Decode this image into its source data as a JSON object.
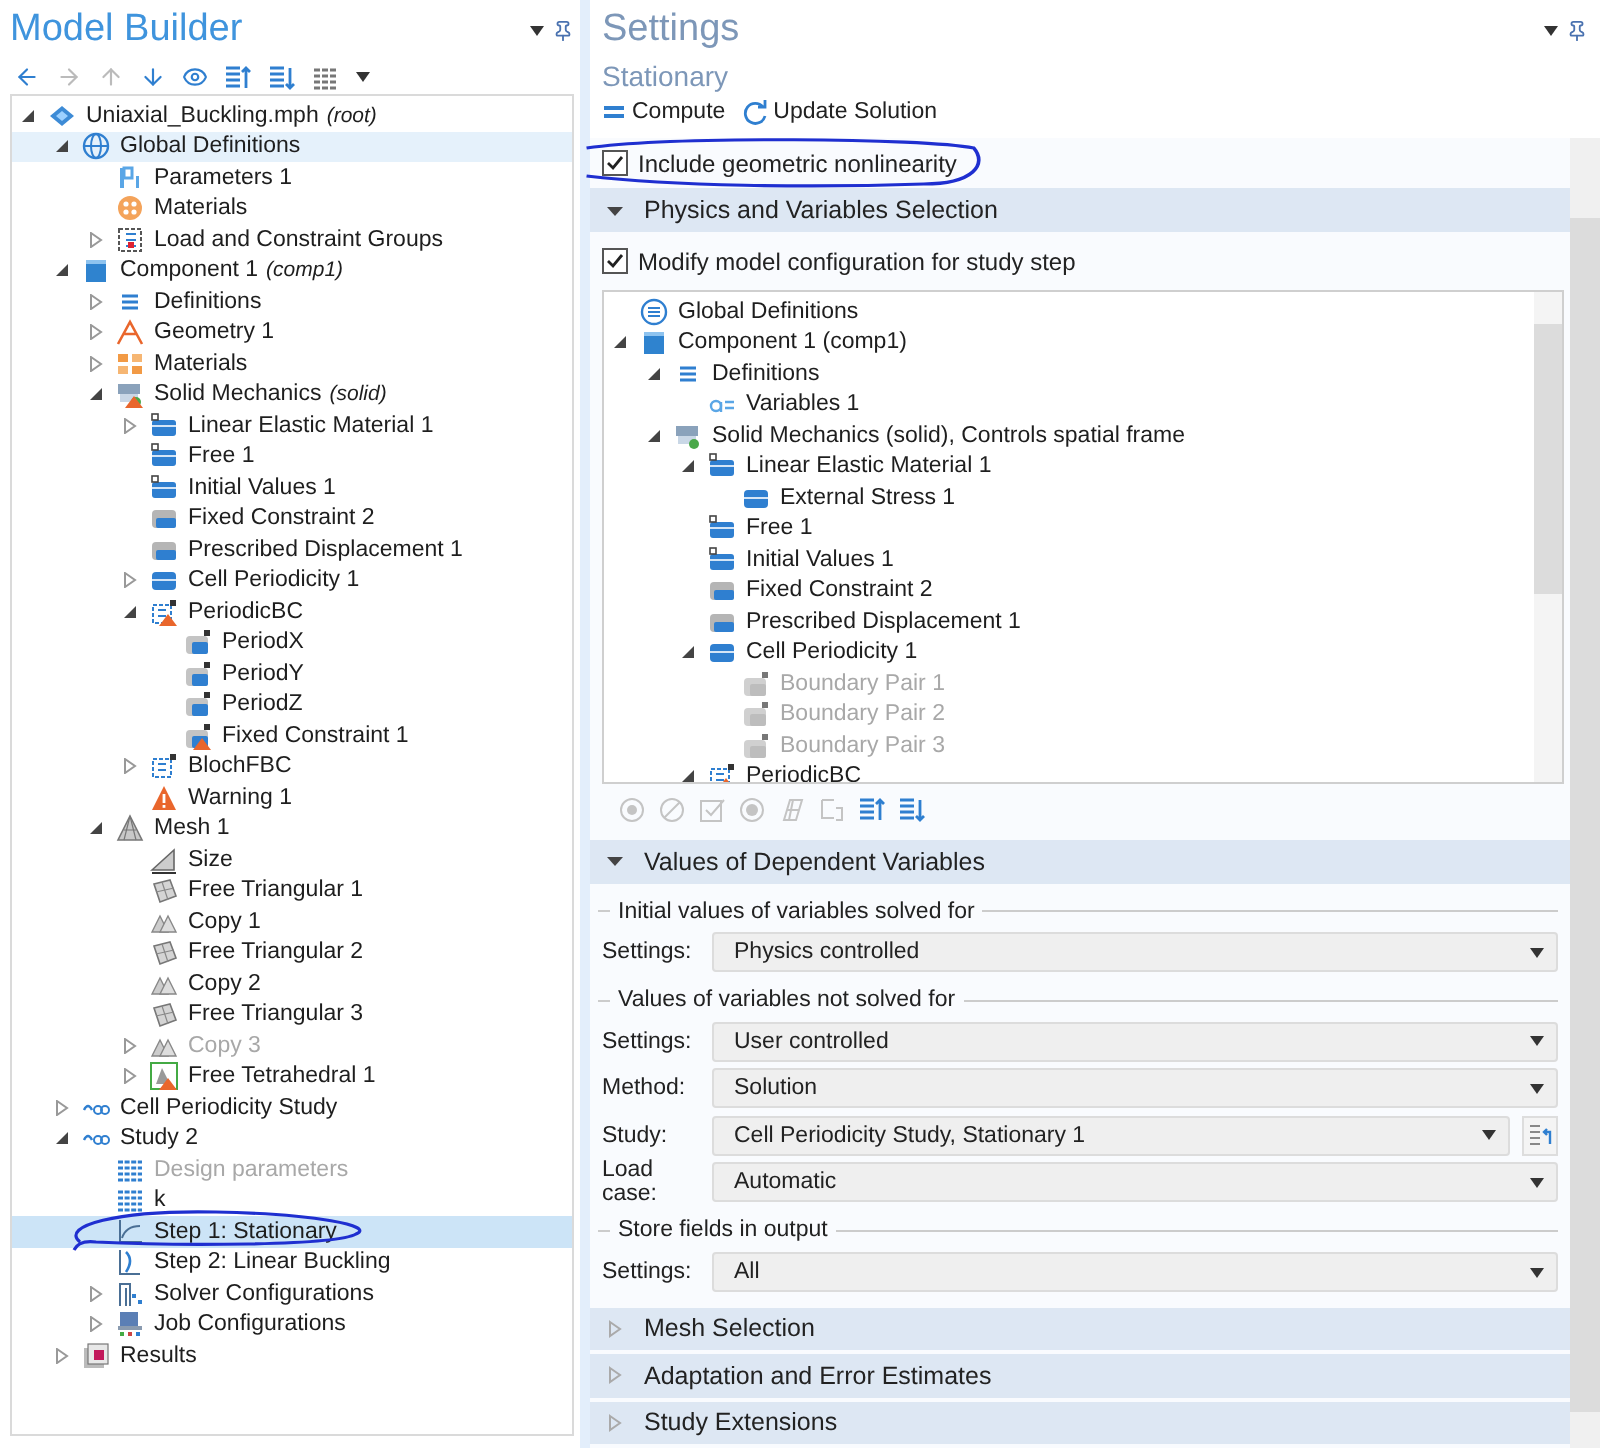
{
  "model_builder": {
    "title": "Model Builder",
    "tree": [
      {
        "label": "Uniaxial_Buckling.mph",
        "note": "(root)",
        "kind": "model",
        "expanded": true,
        "selected": false,
        "children": [
          {
            "label": "Global Definitions",
            "kind": "globe",
            "expanded": true,
            "selected": false,
            "hovered": true,
            "children": [
              {
                "label": "Parameters 1",
                "kind": "param",
                "selected": false
              },
              {
                "label": "Materials",
                "kind": "material",
                "selected": false
              },
              {
                "label": "Load and Constraint Groups",
                "kind": "group",
                "expanded": false,
                "selected": false
              }
            ]
          },
          {
            "label": "Component 1",
            "note": "(comp1)",
            "kind": "component",
            "expanded": true,
            "selected": false,
            "children": [
              {
                "label": "Definitions",
                "kind": "list",
                "expanded": false,
                "selected": false
              },
              {
                "label": "Geometry 1",
                "kind": "geometry",
                "expanded": false,
                "selected": false
              },
              {
                "label": "Materials",
                "kind": "blocks",
                "expanded": false,
                "selected": false
              },
              {
                "label": "Solid Mechanics",
                "note": "(solid)",
                "kind": "physics",
                "warning": true,
                "expanded": true,
                "selected": false,
                "children": [
                  {
                    "label": "Linear Elastic Material 1",
                    "kind": "domain",
                    "expanded": false,
                    "selected": false
                  },
                  {
                    "label": "Free 1",
                    "kind": "domain",
                    "selected": false
                  },
                  {
                    "label": "Initial Values 1",
                    "kind": "domain",
                    "selected": false
                  },
                  {
                    "label": "Fixed Constraint 2",
                    "kind": "boundary-grey",
                    "selected": false
                  },
                  {
                    "label": "Prescribed Displacement 1",
                    "kind": "boundary-grey",
                    "selected": false
                  },
                  {
                    "label": "Cell Periodicity 1",
                    "kind": "boundary",
                    "expanded": false,
                    "selected": false
                  },
                  {
                    "label": "PeriodicBC",
                    "kind": "periodic",
                    "warning": true,
                    "expanded": true,
                    "selected": false,
                    "children": [
                      {
                        "label": "PeriodX",
                        "kind": "pair",
                        "selected": false
                      },
                      {
                        "label": "PeriodY",
                        "kind": "pair",
                        "selected": false
                      },
                      {
                        "label": "PeriodZ",
                        "kind": "pair",
                        "selected": false
                      },
                      {
                        "label": "Fixed Constraint 1",
                        "kind": "pair",
                        "warning": true,
                        "selected": false
                      }
                    ]
                  },
                  {
                    "label": "BlochFBC",
                    "kind": "periodic",
                    "expanded": false,
                    "selected": false
                  },
                  {
                    "label": "Warning 1",
                    "kind": "warning",
                    "selected": false
                  }
                ]
              },
              {
                "label": "Mesh 1",
                "kind": "mesh",
                "expanded": true,
                "selected": false,
                "children": [
                  {
                    "label": "Size",
                    "kind": "mesh-size",
                    "selected": false
                  },
                  {
                    "label": "Free Triangular 1",
                    "kind": "tri",
                    "selected": false
                  },
                  {
                    "label": "Copy 1",
                    "kind": "copy",
                    "selected": false
                  },
                  {
                    "label": "Free Triangular 2",
                    "kind": "tri",
                    "selected": false
                  },
                  {
                    "label": "Copy 2",
                    "kind": "copy",
                    "selected": false
                  },
                  {
                    "label": "Free Triangular 3",
                    "kind": "tri",
                    "selected": false
                  },
                  {
                    "label": "Copy 3",
                    "kind": "copy",
                    "disabled": true,
                    "expanded": false,
                    "selected": false
                  },
                  {
                    "label": "Free Tetrahedral 1",
                    "kind": "tetra",
                    "warning": true,
                    "expanded": false,
                    "selected": false
                  }
                ]
              }
            ]
          },
          {
            "label": "Cell Periodicity Study",
            "kind": "study",
            "expanded": false,
            "selected": false
          },
          {
            "label": "Study 2",
            "kind": "study",
            "expanded": true,
            "selected": false,
            "children": [
              {
                "label": "Design parameters",
                "kind": "table",
                "disabled": true,
                "selected": false
              },
              {
                "label": "k",
                "kind": "table",
                "selected": false
              },
              {
                "label": "Step 1: Stationary",
                "kind": "stationary",
                "selected": true
              },
              {
                "label": "Step 2: Linear Buckling",
                "kind": "buckling",
                "selected": false
              },
              {
                "label": "Solver Configurations",
                "kind": "solver",
                "expanded": false,
                "selected": false
              },
              {
                "label": "Job Configurations",
                "kind": "job",
                "expanded": false,
                "selected": false
              }
            ]
          },
          {
            "label": "Results",
            "kind": "results",
            "expanded": false,
            "selected": false
          }
        ]
      }
    ]
  },
  "settings": {
    "title": "Settings",
    "subtitle": "Stationary",
    "toolbar": [
      {
        "label": "Compute",
        "kind": "compute"
      },
      {
        "label": "Update Solution",
        "kind": "refresh"
      }
    ],
    "geometric_nonlinearity": {
      "label": "Include geometric nonlinearity",
      "checked": true
    },
    "sections": [
      {
        "title": "Physics and Variables Selection",
        "kind": "physics",
        "expanded": true,
        "modify": {
          "label": "Modify model configuration for study step",
          "checked": true
        },
        "tree": [
          {
            "label": "Global Definitions",
            "kind": "list-circle"
          },
          {
            "label": "Component 1 (comp1)",
            "kind": "component",
            "expanded": true,
            "children": [
              {
                "label": "Definitions",
                "kind": "list",
                "expanded": true,
                "children": [
                  {
                    "label": "Variables 1",
                    "kind": "variable"
                  }
                ]
              },
              {
                "label": "Solid Mechanics (solid), Controls spatial frame",
                "kind": "physics",
                "expanded": true,
                "children": [
                  {
                    "label": "Linear Elastic Material 1",
                    "kind": "domain",
                    "expanded": true,
                    "children": [
                      {
                        "label": "External Stress 1",
                        "kind": "boundary"
                      }
                    ]
                  },
                  {
                    "label": "Free 1",
                    "kind": "domain"
                  },
                  {
                    "label": "Initial Values 1",
                    "kind": "domain"
                  },
                  {
                    "label": "Fixed Constraint 2",
                    "kind": "boundary-grey"
                  },
                  {
                    "label": "Prescribed Displacement 1",
                    "kind": "boundary-grey"
                  },
                  {
                    "label": "Cell Periodicity 1",
                    "kind": "boundary",
                    "expanded": true,
                    "children": [
                      {
                        "label": "Boundary Pair 1",
                        "kind": "pair-grey",
                        "disabled": true
                      },
                      {
                        "label": "Boundary Pair 2",
                        "kind": "pair-grey",
                        "disabled": true
                      },
                      {
                        "label": "Boundary Pair 3",
                        "kind": "pair-grey",
                        "disabled": true
                      }
                    ]
                  },
                  {
                    "label": "PeriodicBC",
                    "kind": "periodic",
                    "warning": true,
                    "expanded": true
                  }
                ]
              }
            ]
          }
        ],
        "tools": [
          {
            "kind": "enable",
            "disabled": true
          },
          {
            "kind": "disable",
            "disabled": true
          },
          {
            "kind": "check",
            "disabled": true
          },
          {
            "kind": "radio",
            "disabled": true
          },
          {
            "kind": "grid",
            "disabled": true
          },
          {
            "kind": "sum",
            "disabled": true
          },
          {
            "kind": "collapse",
            "disabled": false
          },
          {
            "kind": "expand",
            "disabled": false
          }
        ]
      },
      {
        "title": "Values of Dependent Variables",
        "kind": "values",
        "expanded": true,
        "groups": [
          {
            "title": "Initial values of variables solved for",
            "fields": [
              {
                "label": "Settings:",
                "value": "Physics controlled",
                "kind": "select"
              }
            ]
          },
          {
            "title": "Values of variables not solved for",
            "fields": [
              {
                "label": "Settings:",
                "value": "User controlled",
                "kind": "select"
              },
              {
                "label": "Method:",
                "value": "Solution",
                "kind": "select"
              },
              {
                "label": "Study:",
                "value": "Cell Periodicity Study, Stationary 1",
                "kind": "select-action"
              },
              {
                "label": "Load case:",
                "value": "Automatic",
                "kind": "select"
              }
            ]
          },
          {
            "title": "Store fields in output",
            "fields": [
              {
                "label": "Settings:",
                "value": "All",
                "kind": "select"
              }
            ]
          }
        ]
      },
      {
        "title": "Mesh Selection",
        "expanded": false
      },
      {
        "title": "Adaptation and Error Estimates",
        "expanded": false
      },
      {
        "title": "Study Extensions",
        "expanded": false
      }
    ]
  }
}
